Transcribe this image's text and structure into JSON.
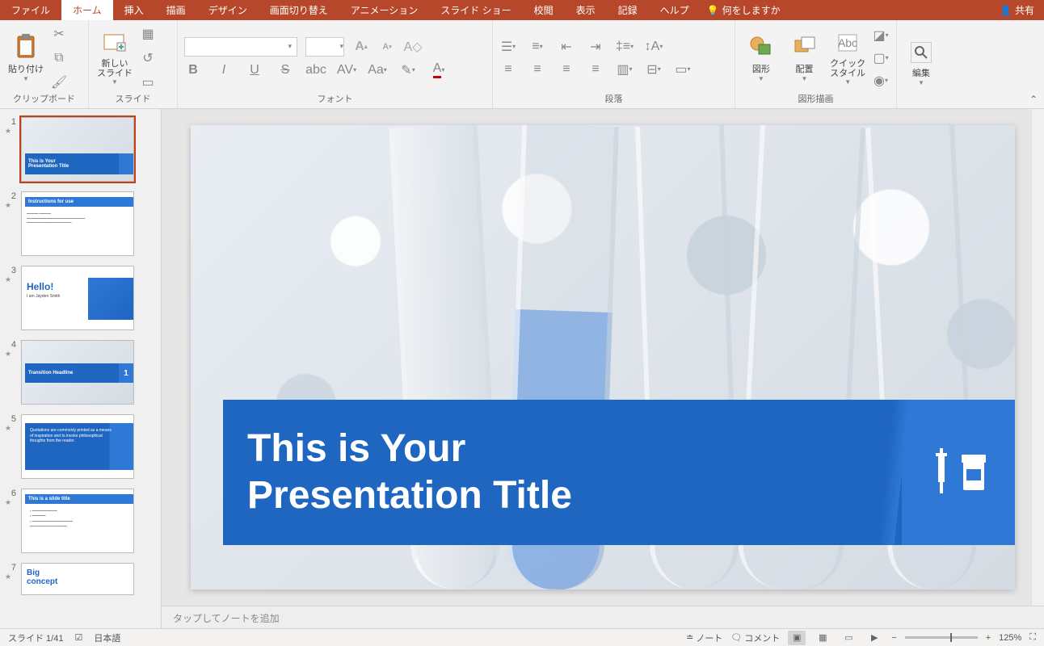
{
  "tabs": [
    "ファイル",
    "ホーム",
    "挿入",
    "描画",
    "デザイン",
    "画面切り替え",
    "アニメーション",
    "スライド ショー",
    "校閲",
    "表示",
    "記録",
    "ヘルプ"
  ],
  "active_tab": "ホーム",
  "tell_me": "何をしますか",
  "share": "共有",
  "ribbon": {
    "clipboard": {
      "label": "クリップボード",
      "paste": "貼り付け"
    },
    "slides": {
      "label": "スライド",
      "new_slide": "新しい\nスライド"
    },
    "font": {
      "label": "フォント"
    },
    "paragraph": {
      "label": "段落"
    },
    "drawing": {
      "label": "図形描画",
      "shapes": "図形",
      "arrange": "配置",
      "quick_styles": "クイック\nスタイル"
    },
    "editing": {
      "label": "編集"
    }
  },
  "slide_title": "This is Your\nPresentation Title",
  "thumbnails": [
    {
      "num": "1",
      "title": "This is Your\nPresentation Title",
      "type": "title"
    },
    {
      "num": "2",
      "title": "Instructions for use",
      "type": "instructions"
    },
    {
      "num": "3",
      "title": "Hello!",
      "sub": "I am Jayden Smith",
      "type": "hello"
    },
    {
      "num": "4",
      "title": "Transition Headline",
      "badge": "1",
      "type": "transition"
    },
    {
      "num": "5",
      "title": "Quotations are commonly printed as a means of inspiration and to invoke philosophical thoughts from the reader.",
      "type": "quote"
    },
    {
      "num": "6",
      "title": "This is a slide title",
      "type": "content"
    },
    {
      "num": "7",
      "title": "Big\nconcept",
      "type": "concept"
    }
  ],
  "notes_placeholder": "タップしてノートを追加",
  "status": {
    "slide_counter": "スライド 1/41",
    "language": "日本語",
    "notes": "ノート",
    "comments": "コメント",
    "zoom": "125%"
  }
}
